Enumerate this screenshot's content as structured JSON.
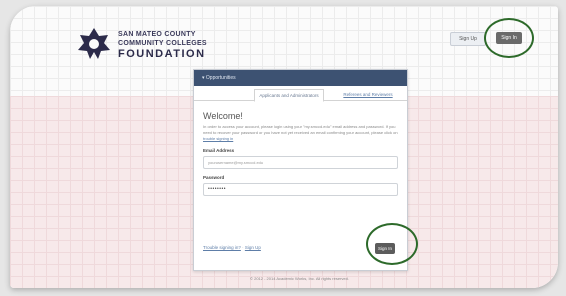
{
  "brand": {
    "line1": "SAN MATEO COUNTY",
    "line2": "COMMUNITY COLLEGES",
    "line3": "FOUNDATION",
    "logo_icon": "foundation-logo-icon"
  },
  "header": {
    "signup_label": "Sign Up",
    "signin_label": "Sign In"
  },
  "card": {
    "title": "▾ Opportunities",
    "tabs": [
      {
        "label": "Applicants and Administrators",
        "active": true
      },
      {
        "label": "Referees and Reviewers",
        "active": false
      }
    ],
    "welcome": "Welcome!",
    "intro": "In order to access your account, please login using your \"my.smccd.edu\" email address and password. If you need to recover your password or you have not yet received an email confirming your account, please click on",
    "intro_link": "trouble signing in",
    "email_label": "Email Address",
    "email_placeholder": "yourusername@my.smccd.edu",
    "password_label": "Password",
    "password_value": "••••••••",
    "trouble_link": "Trouble signing in?",
    "signup_link": "Sign Up",
    "separator": " · ",
    "signin_button": "Sign In"
  },
  "footer": {
    "copyright": "© 2012 - 2014 Academic Works, Inc. All rights reserved."
  },
  "colors": {
    "card_header": "#3d5272",
    "highlight_circle": "#2d6a2a",
    "pink_band": "#f7e9ea"
  }
}
